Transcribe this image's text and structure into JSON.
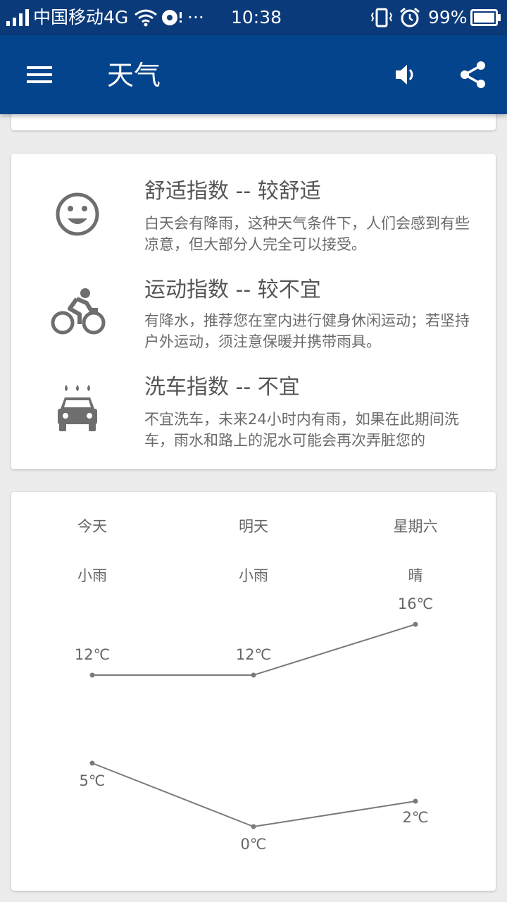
{
  "status_bar": {
    "carrier": "中国移动4G",
    "more": "···",
    "time": "10:38",
    "battery": "99%"
  },
  "app_bar": {
    "title": "天气",
    "icons": [
      "menu-icon",
      "volume-icon",
      "share-icon"
    ]
  },
  "indices": [
    {
      "icon": "smile-face-icon",
      "title": "舒适指数 -- 较舒适",
      "desc": "白天会有降雨，这种天气条件下，人们会感到有些凉意，但大部分人完全可以接受。"
    },
    {
      "icon": "bicycle-icon",
      "title": "运动指数 -- 较不宜",
      "desc": "有降水，推荐您在室内进行健身休闲运动；若坚持户外运动，须注意保暖并携带雨具。"
    },
    {
      "icon": "car-wash-icon",
      "title": "洗车指数 -- 不宜",
      "desc": "不宜洗车，未来24小时内有雨，如果在此期间洗车，雨水和路上的泥水可能会再次弄脏您的"
    }
  ],
  "forecast": {
    "days": [
      "今天",
      "明天",
      "星期六"
    ],
    "conditions": [
      "小雨",
      "小雨",
      "晴"
    ]
  },
  "chart_data": {
    "type": "line",
    "categories": [
      "今天",
      "明天",
      "星期六"
    ],
    "series": [
      {
        "values": [
          12,
          12,
          16
        ],
        "labels": [
          "12℃",
          "12℃",
          "16℃"
        ]
      },
      {
        "values": [
          5,
          0,
          2
        ],
        "labels": [
          "5℃",
          "0℃",
          "2℃"
        ]
      }
    ],
    "line_color": "#7a7a7a"
  }
}
